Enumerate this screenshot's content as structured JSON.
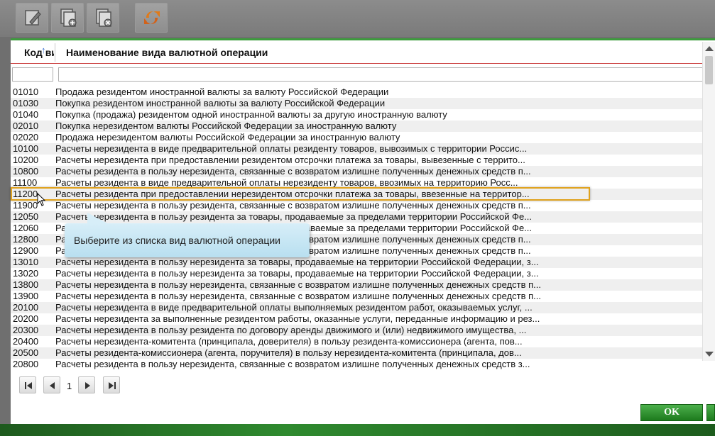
{
  "toolbar": {
    "buttons": [
      {
        "icon": "edit-icon"
      },
      {
        "icon": "add-document-icon"
      },
      {
        "icon": "delete-document-icon"
      },
      {
        "icon": "refresh-icon"
      }
    ]
  },
  "table": {
    "header": {
      "code": "Код вида",
      "name": "Наименование вида валютной операции"
    },
    "rows": [
      {
        "code": "01010",
        "name": "Продажа резидентом иностранной валюты за валюту Российской Федерации"
      },
      {
        "code": "01030",
        "name": "Покупка резидентом иностранной валюты за валюту Российской Федерации"
      },
      {
        "code": "01040",
        "name": "Покупка (продажа) резидентом одной иностранной валюты за другую иностранную валюту"
      },
      {
        "code": "02010",
        "name": "Покупка нерезидентом валюты Российской Федерации за иностранную валюту"
      },
      {
        "code": "02020",
        "name": "Продажа нерезидентом валюты Российской Федерации за иностранную валюту"
      },
      {
        "code": "10100",
        "name": "Расчеты нерезидента в виде предварительной оплаты резиденту товаров, вывозимых с территории Россис..."
      },
      {
        "code": "10200",
        "name": "Расчеты нерезидента при предоставлении резидентом отсрочки платежа за товары, вывезенные с террито..."
      },
      {
        "code": "10800",
        "name": "Расчеты резидента в пользу нерезидента, связанные с возвратом излишне полученных денежных средств п..."
      },
      {
        "code": "11100",
        "name": "Расчеты резидента в виде предварительной оплаты нерезиденту товаров, ввозимых на территорию Росс..."
      },
      {
        "code": "11200",
        "name": "Расчеты резидента при предоставлении нерезидентом отсрочки платежа за товары, ввезенные на территор..."
      },
      {
        "code": "11900",
        "name": "Расчеты нерезидента в пользу резидента, связанные с возвратом излишне полученных денежных средств п..."
      },
      {
        "code": "12050",
        "name": "Расчеты нерезидента в пользу резидента за товары, продаваемые за пределами территории Российской Фе..."
      },
      {
        "code": "12060",
        "name": "Расчеты нерезидента в пользу резидента за товары, продаваемые за пределами территории Российской Фе..."
      },
      {
        "code": "12800",
        "name": "Расчеты нерезидента в пользу резидента, связанные с возвратом излишне полученных денежных средств п..."
      },
      {
        "code": "12900",
        "name": "Расчеты резидента в пользу нерезидента, связанные с возвратом излишне полученных денежных средств п..."
      },
      {
        "code": "13010",
        "name": "Расчеты нерезидента в пользу нерезидента за товары, продаваемые на территории Российской Федерации, з..."
      },
      {
        "code": "13020",
        "name": "Расчеты нерезидента в пользу нерезидента за товары, продаваемые на территории Российской Федерации, з..."
      },
      {
        "code": "13800",
        "name": "Расчеты нерезидента в пользу нерезидента, связанные с возвратом излишне полученных денежных средств п..."
      },
      {
        "code": "13900",
        "name": "Расчеты нерезидента в пользу нерезидента, связанные с возвратом излишне полученных денежных средств п..."
      },
      {
        "code": "20100",
        "name": "Расчеты нерезидента в виде предварительной оплаты выполняемых резидентом работ, оказываемых услуг, ..."
      },
      {
        "code": "20200",
        "name": "Расчеты нерезидента за выполненные резидентом работы, оказанные услуги, переданные информацию и рез..."
      },
      {
        "code": "20300",
        "name": "Расчеты нерезидента в пользу резидента по договору аренды движимого и (или) недвижимого имущества, ..."
      },
      {
        "code": "20400",
        "name": "Расчеты нерезидента-комитента (принципала, доверителя) в пользу резидента-комиссионера (агента, пов..."
      },
      {
        "code": "20500",
        "name": "Расчеты резидента-комиссионера (агента, поручителя) в пользу нерезидента-комитента (принципала, дов..."
      },
      {
        "code": "20800",
        "name": "Расчеты резидента в пользу нерезидента, связанные с возвратом излишне полученных денежных средств з..."
      }
    ]
  },
  "tooltip": {
    "text": "Выберите из списка вид валютной операции"
  },
  "pager": {
    "page": "1"
  },
  "buttons": {
    "ok": "OK"
  },
  "colors": {
    "accent_green": "#3d9b3d",
    "highlight_border": "#e0a21d",
    "tooltip_bg": "#c6e6f4"
  }
}
